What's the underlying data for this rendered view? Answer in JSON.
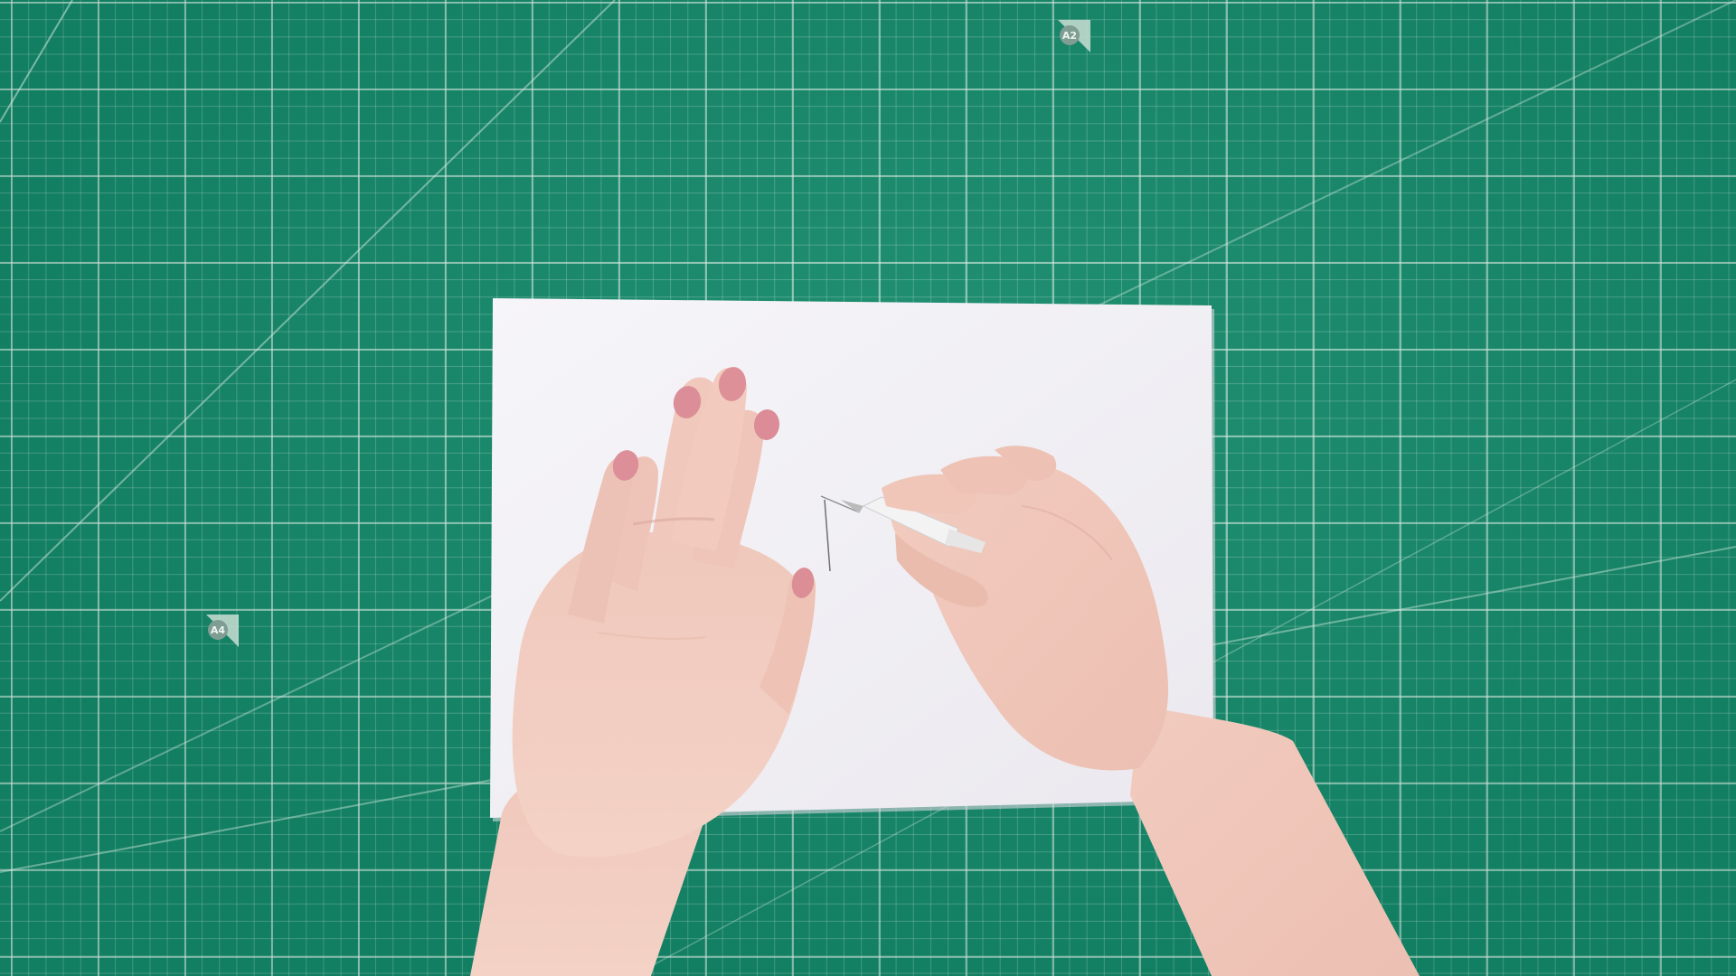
{
  "scene": {
    "description_type": "photo",
    "mat_markers": [
      {
        "label": "A2"
      },
      {
        "label": "A4"
      }
    ],
    "colors": {
      "mat": "#14896a",
      "grid": "#d8efe4",
      "paper": "#f4f2f6",
      "skin": "#ecc4b8",
      "nails": "#d98a94",
      "pencil": "#f2f2f2"
    }
  }
}
